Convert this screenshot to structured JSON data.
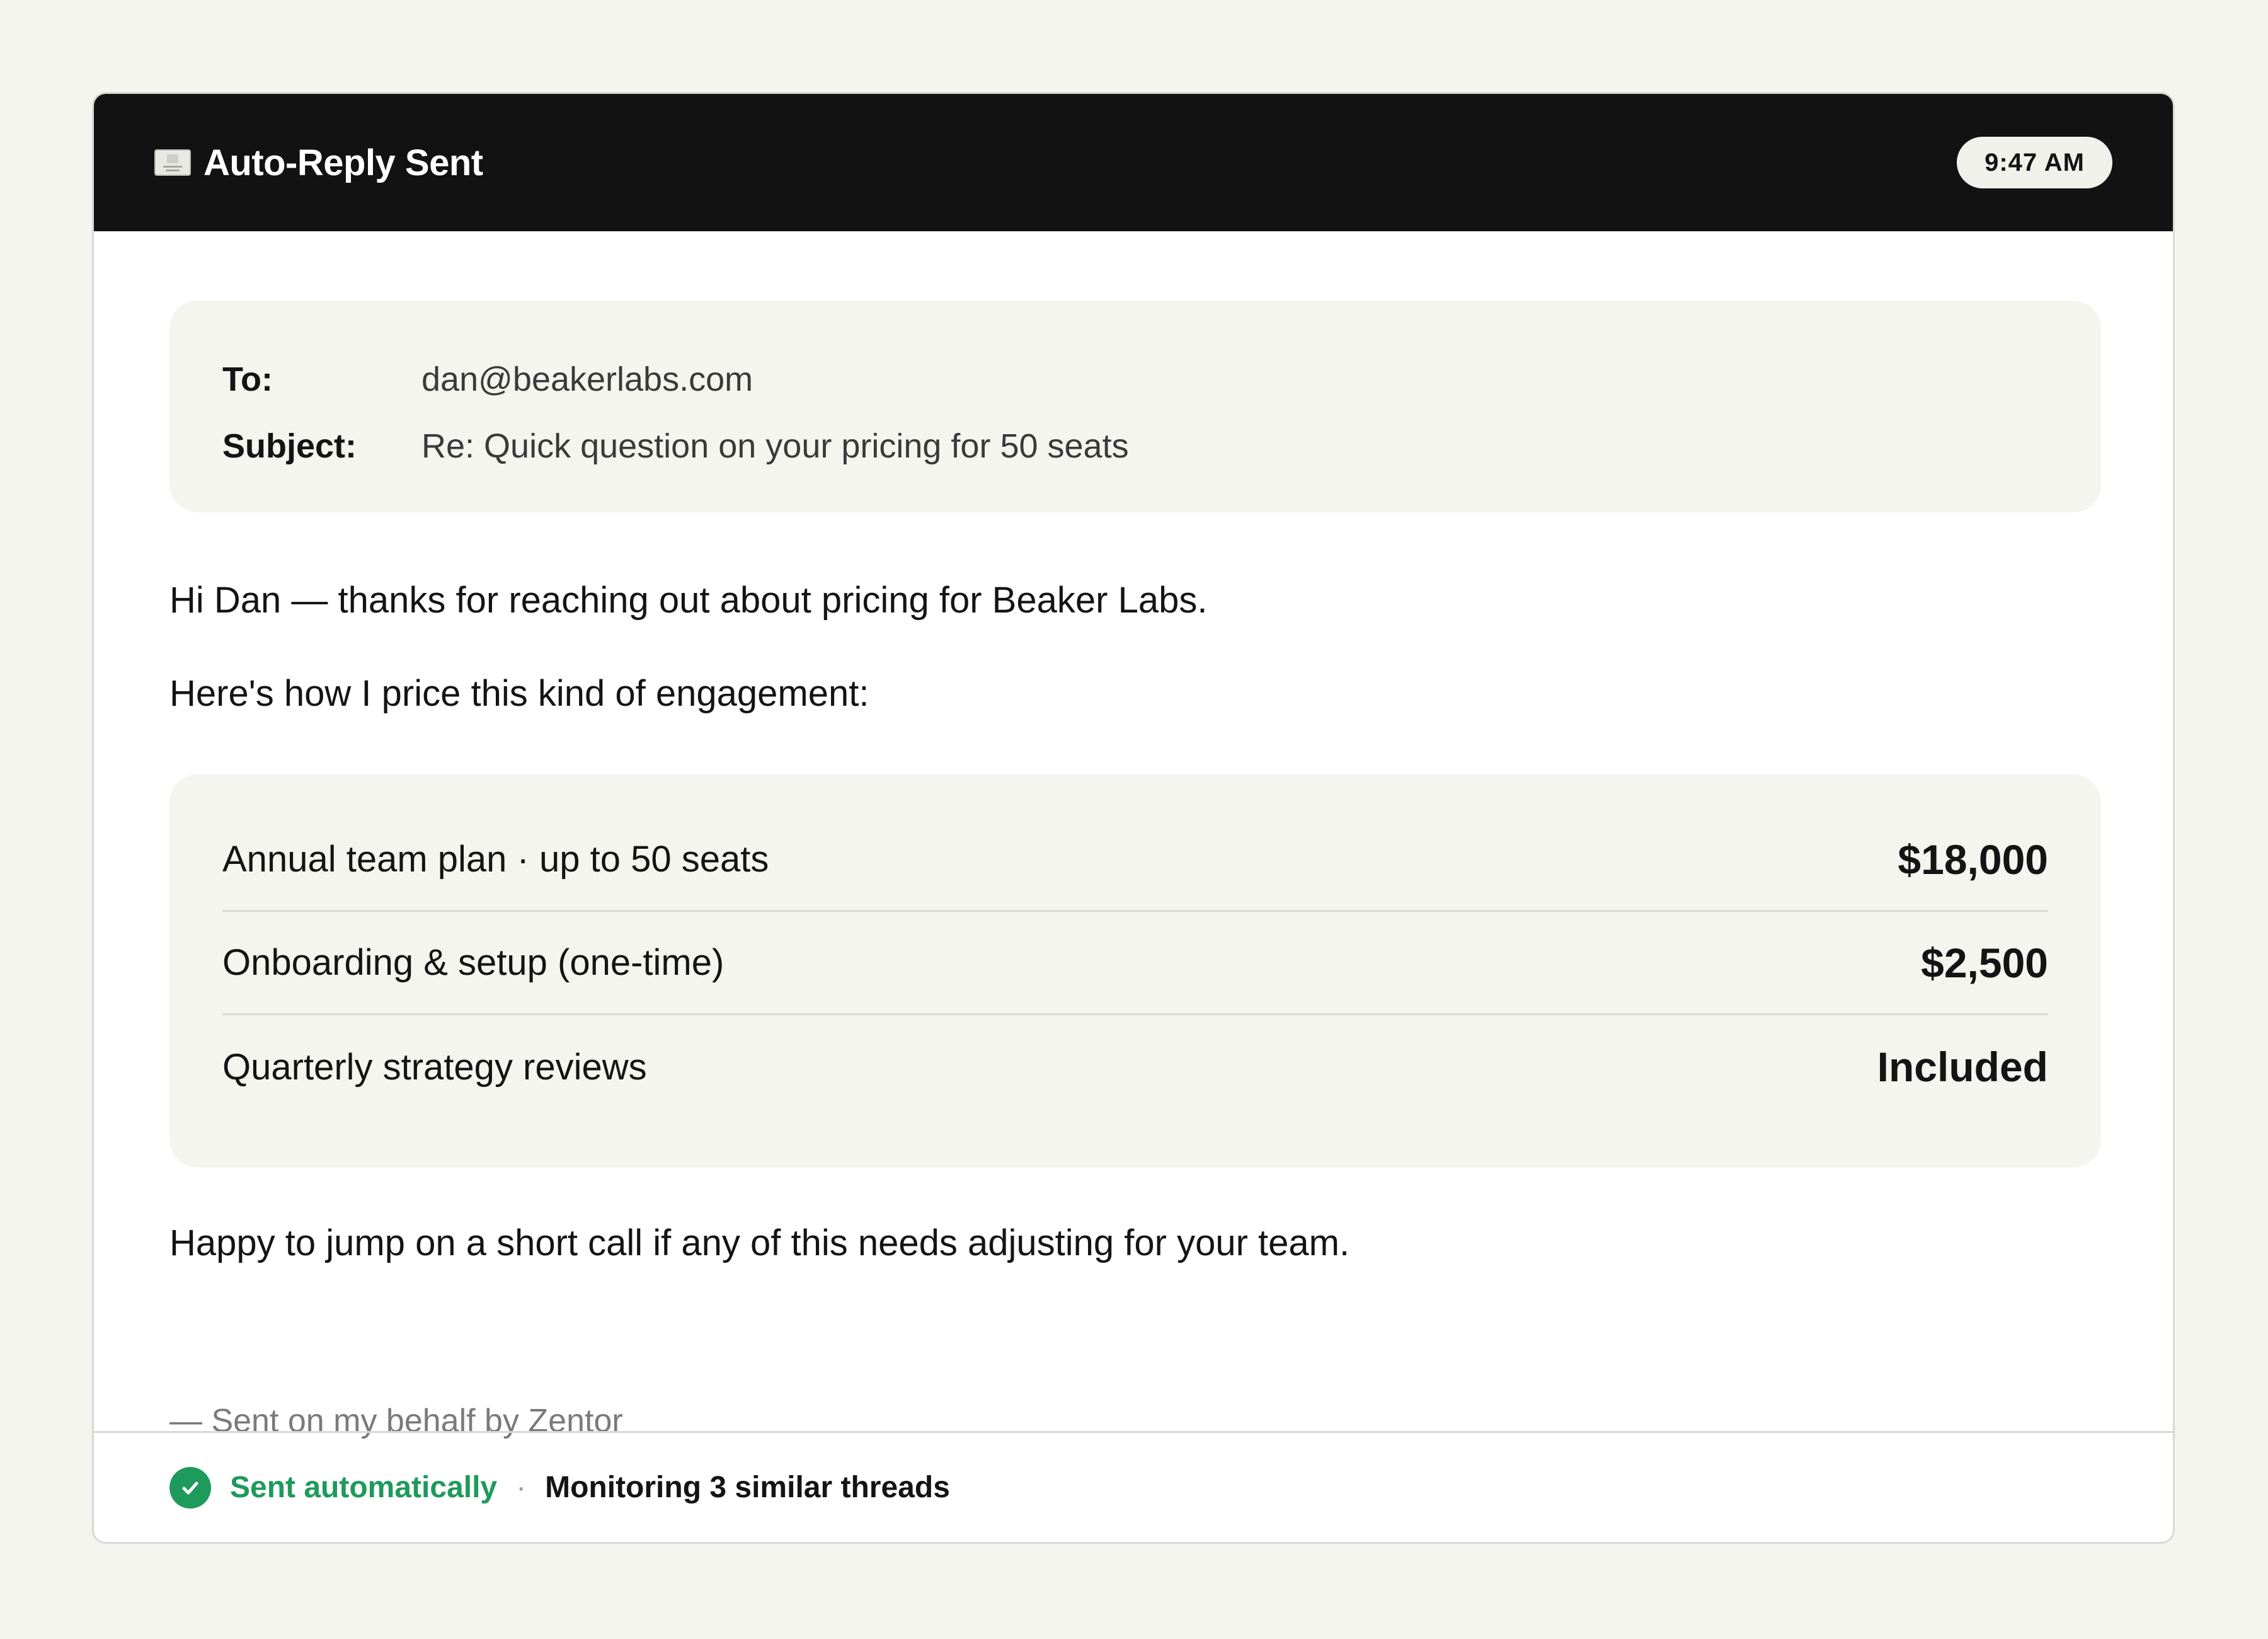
{
  "header": {
    "title": "Auto-Reply Sent",
    "time": "9:47 AM",
    "icon": "envelope-icon"
  },
  "email": {
    "to_label": "To:",
    "to_value": "dan@beakerlabs.com",
    "subject_label": "Subject:",
    "subject_value": "Re: Quick question on your pricing for 50 seats"
  },
  "body": {
    "greeting": "Hi Dan — thanks for reaching out about pricing for Beaker Labs.",
    "intro": "Here's how I price this kind of engagement:",
    "closing": "Happy to jump on a short call if any of this needs adjusting for your team.",
    "signoff": "— Sent on my behalf by Zentor"
  },
  "pricing": [
    {
      "item": "Annual team plan · up to 50 seats",
      "amount": "$18,000"
    },
    {
      "item": "Onboarding & setup (one-time)",
      "amount": "$2,500"
    },
    {
      "item": "Quarterly strategy reviews",
      "amount": "Included"
    }
  ],
  "footer": {
    "status": "Sent automatically",
    "separator": "·",
    "monitoring": "Monitoring 3 similar threads",
    "status_color": "#1e9a5b"
  }
}
